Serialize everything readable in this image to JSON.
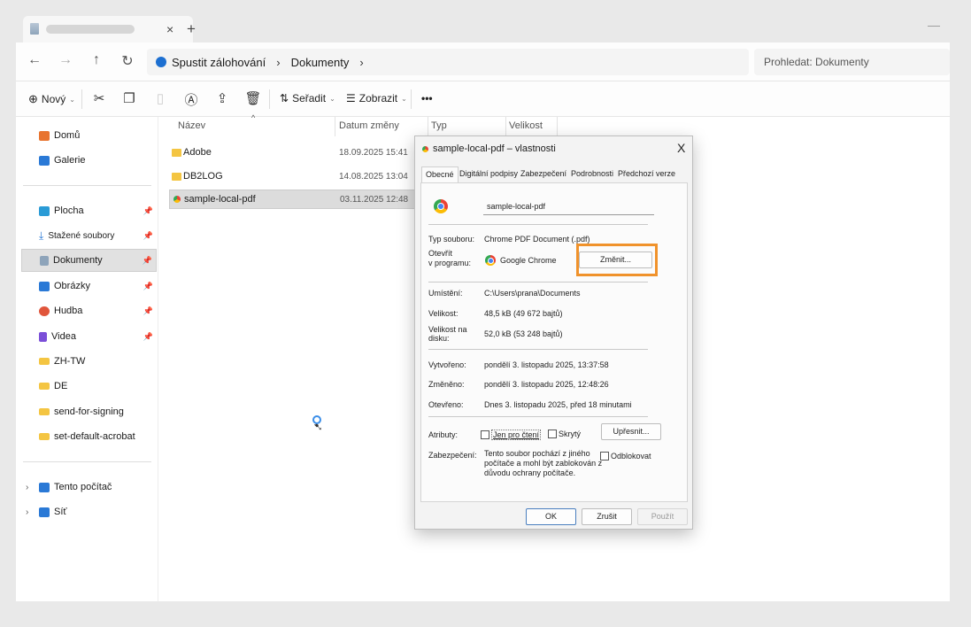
{
  "tab": {
    "title": "",
    "close": "×",
    "new": "+"
  },
  "window": {
    "minimize": "—"
  },
  "nav": {
    "back": "←",
    "forward": "→",
    "up": "↑",
    "refresh": "↻",
    "breadcrumb": [
      "Spustit zálohování",
      "Dokumenty"
    ],
    "separator": "›",
    "search_placeholder": "Prohledat: Dokumenty"
  },
  "toolbar": {
    "new": "Nový",
    "sort": "Seřadit",
    "view": "Zobrazit",
    "more": "•••"
  },
  "sidebar": {
    "items": [
      {
        "label": "Domů",
        "icon": "home-icon",
        "color": "#e8742f"
      },
      {
        "label": "Galerie",
        "icon": "gallery-icon",
        "color": "#2a79d6"
      },
      {
        "label": "Plocha",
        "icon": "desktop-icon",
        "color": "#2a9bd6"
      },
      {
        "label": "Stažené soubory",
        "icon": "download-icon",
        "color": "#2a79d6"
      },
      {
        "label": "Dokumenty",
        "icon": "documents-icon",
        "color": "#8ea4ba"
      },
      {
        "label": "Obrázky",
        "icon": "pictures-icon",
        "color": "#2a79d6"
      },
      {
        "label": "Hudba",
        "icon": "music-icon",
        "color": "#e0553b"
      },
      {
        "label": "Videa",
        "icon": "videos-icon",
        "color": "#7b4fd8"
      },
      {
        "label": "ZH-TW",
        "icon": "folder-icon",
        "color": "#f4c542"
      },
      {
        "label": "DE",
        "icon": "folder-icon",
        "color": "#f4c542"
      },
      {
        "label": "send-for-signing",
        "icon": "folder-icon",
        "color": "#f4c542"
      },
      {
        "label": "set-default-acrobat",
        "icon": "folder-icon",
        "color": "#f4c542"
      },
      {
        "label": "Tento počítač",
        "icon": "computer-icon",
        "color": "#2a79d6"
      },
      {
        "label": "Síť",
        "icon": "network-icon",
        "color": "#2a79d6"
      }
    ]
  },
  "columns": {
    "name": "Název",
    "date": "Datum změny",
    "type": "Typ",
    "size": "Velikost"
  },
  "files": [
    {
      "name": "Adobe",
      "date": "18.09.2025 15:41"
    },
    {
      "name": "DB2LOG",
      "date": "14.08.2025 13:04"
    },
    {
      "name": "sample-local-pdf",
      "date": "03.11.2025 12:48"
    }
  ],
  "dialog": {
    "title": "sample-local-pdf – vlastnosti",
    "close": "X",
    "tabs": [
      "Obecné",
      "Digitální podpisy",
      "Zabezpečení",
      "Podrobnosti",
      "Předchozí verze"
    ],
    "filename": "sample-local-pdf",
    "labels": {
      "type": "Typ souboru:",
      "opens_with_1": "Otevřít",
      "opens_with_2": "v programu:",
      "location": "Umístění:",
      "size": "Velikost:",
      "size_on_disk_1": "Velikost na",
      "size_on_disk_2": "disku:",
      "created": "Vytvořeno:",
      "modified": "Změněno:",
      "accessed": "Otevřeno:",
      "attributes": "Atributy:",
      "security": "Zabezpečení:"
    },
    "values": {
      "type": "Chrome PDF Document (.pdf)",
      "opens_with": "Google Chrome",
      "location": "C:\\Users\\prana\\Documents",
      "size": "48,5 kB (49 672 bajtů)",
      "size_on_disk": "52,0 kB (53 248 bajtů)",
      "created": "pondělí 3. listopadu 2025, 13:37:58",
      "modified": "pondělí 3. listopadu 2025, 12:48:26",
      "accessed": "Dnes 3. listopadu 2025, před 18 minutami",
      "security_text_1": "Tento soubor pochází z jiného",
      "security_text_2": "počítače a mohl být zablokován z",
      "security_text_3": "důvodu ochrany počítače."
    },
    "buttons": {
      "change": "Změnit...",
      "advanced": "Upřesnit...",
      "ok": "OK",
      "cancel": "Zrušit",
      "apply": "Použít"
    },
    "checkboxes": {
      "readonly": "Jen pro čtení",
      "hidden": "Skrytý",
      "unblock": "Odblokovat"
    }
  }
}
